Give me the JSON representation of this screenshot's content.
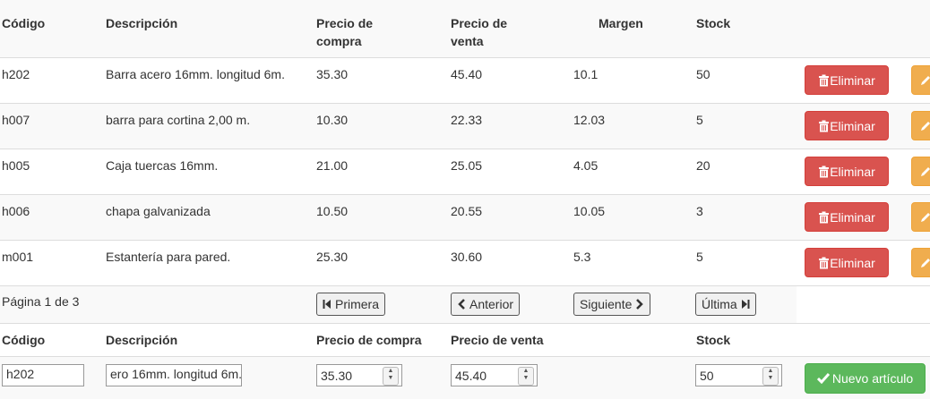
{
  "header": {
    "codigo": "Código",
    "descripcion": "Descripción",
    "precio_compra_1": "Precio de",
    "precio_compra_2": "compra",
    "precio_venta_1": "Precio de",
    "precio_venta_2": "venta",
    "margen": "Margen",
    "stock": "Stock"
  },
  "rows": [
    {
      "codigo": "h202",
      "descripcion": "Barra acero 16mm. longitud 6m.",
      "compra": "35.30",
      "venta": "45.40",
      "margen": "10.1",
      "stock": "50"
    },
    {
      "codigo": "h007",
      "descripcion": "barra para cortina 2,00 m.",
      "compra": "10.30",
      "venta": "22.33",
      "margen": "12.03",
      "stock": "5"
    },
    {
      "codigo": "h005",
      "descripcion": "Caja tuercas 16mm.",
      "compra": "21.00",
      "venta": "25.05",
      "margen": "4.05",
      "stock": "20"
    },
    {
      "codigo": "h006",
      "descripcion": "chapa galvanizada",
      "compra": "10.50",
      "venta": "20.55",
      "margen": "10.05",
      "stock": "3"
    },
    {
      "codigo": "m001",
      "descripcion": "Estantería para pared.",
      "compra": "25.30",
      "venta": "30.60",
      "margen": "5.3",
      "stock": "5"
    }
  ],
  "actions": {
    "delete_label": "Eliminar"
  },
  "pagination": {
    "info": "Página 1 de 3",
    "first": "Primera",
    "prev": "Anterior",
    "next": "Siguiente",
    "last": "Última"
  },
  "form": {
    "codigo_label": "Código",
    "descripcion_label": "Descripción",
    "compra_label": "Precio de compra",
    "venta_label": "Precio de venta",
    "stock_label": "Stock",
    "codigo_value": "h202",
    "descripcion_value": "ero 16mm. longitud 6m.",
    "compra_value": "35.30",
    "venta_value": "45.40",
    "stock_value": "50",
    "submit_label": "Nuevo artículo"
  },
  "icons": {
    "trash": "trash-icon",
    "pencil": "pencil-icon",
    "check": "check-icon",
    "first": "step-backward-icon",
    "prev": "chevron-left-icon",
    "next": "chevron-right-icon",
    "last": "step-forward-icon"
  },
  "colors": {
    "danger": "#d9534f",
    "warning": "#f0ad4e",
    "success": "#5cb85c",
    "stripe": "#f9f9f9"
  }
}
